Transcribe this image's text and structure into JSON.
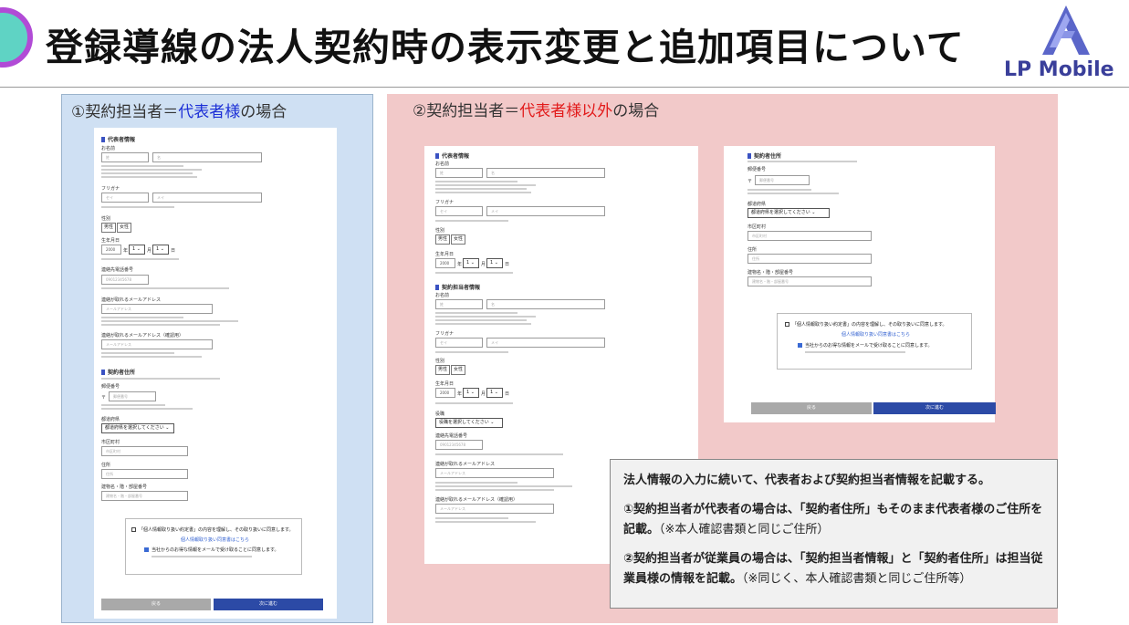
{
  "header": {
    "title": "登録導線の法人契約時の表示変更と追加項目について",
    "logo_text": "LP Mobile"
  },
  "panel1": {
    "heading_prefix": "①契約担当者＝",
    "heading_em": "代表者様",
    "heading_suffix": "の場合"
  },
  "panel2": {
    "heading_prefix": "②契約担当者＝",
    "heading_em": "代表者様以外",
    "heading_suffix": "の場合"
  },
  "form": {
    "sec_rep": "代表者情報",
    "sec_staff": "契約担当者情報",
    "sec_addr": "契約者住所",
    "name_label": "お名前",
    "last_name_ph": "姓",
    "first_name_ph": "名",
    "kana_label": "フリガナ",
    "kana_last_ph": "セイ",
    "kana_first_ph": "メイ",
    "gender_label": "性別",
    "male": "男性",
    "female": "女性",
    "birth_label": "生年月日",
    "year": "2000",
    "month": "1",
    "day": "1",
    "nen": "年",
    "gatsu": "月",
    "nichi": "日",
    "role_label": "役職",
    "role_select": "役職を選択してください",
    "phone_label": "連絡先電話番号",
    "phone_ph": "09012345678",
    "email_label": "連絡が取れるメールアドレス",
    "email_ph": "メールアドレス",
    "email_confirm_label": "連絡が取れるメールアドレス（確認用）",
    "postal_label": "郵便番号",
    "postal_mark": "〒",
    "postal_ph": "郵便番号",
    "pref_label": "都道府県",
    "pref_select": "都道府県を選択してください",
    "city_label": "市区町村",
    "city_ph": "市区町村",
    "street_label": "住所",
    "street_ph": "住所",
    "bldg_label": "建物名・階・部屋番号",
    "bldg_ph": "建物名・階・部屋番号",
    "consent": "「個人情報取り扱い約定書」の内容を理解し、その取り扱いに同意します。",
    "consent_link": "個人情報取り扱い同意書はこちら",
    "newsletter": "当社からのお得な情報をメールで受け取ることに同意します。",
    "back": "戻る",
    "next": "次に進む"
  },
  "info": {
    "line1": "法人情報の入力に続いて、代表者および契約担当者情報を記載する。",
    "line2a": "①契約担当者が代表者の場合は、「契約者住所」もそのまま代表者様のご住所を記載。",
    "line2b": "（※本人確認書類と同じご住所）",
    "line3a": "②契約担当者が従業員の場合は、「契約担当者情報」と「契約者住所」は担当従業員様の情報を記載。",
    "line3b": "（※同じく、本人確認書類と同じご住所等）"
  },
  "colors": {
    "accent": "#b14bd6",
    "blue_text": "#1c2fd6",
    "red_text": "#e21b1b",
    "panel1_bg": "#cfe0f3",
    "panel2_bg": "#f2c9c9",
    "brand": "#3a3f9a"
  }
}
